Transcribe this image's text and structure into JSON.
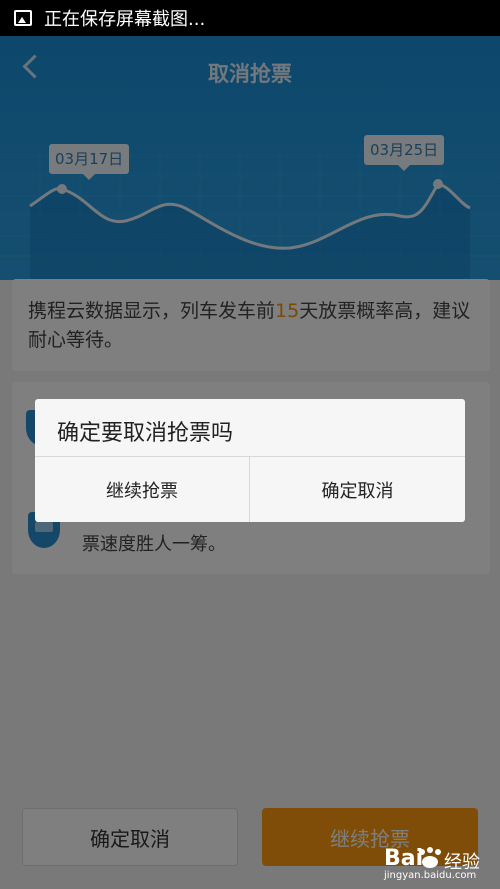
{
  "status_bar": {
    "text": "正在保存屏幕截图..."
  },
  "header": {
    "title": "取消抢票",
    "chart_tags": [
      "03月17日",
      "03月25日"
    ]
  },
  "info": {
    "text_before": "携程云数据显示，列车发车前",
    "highlight": "15",
    "text_after": "天放票概率高，建议耐心等待。"
  },
  "list": {
    "item2_text": "票速度胜人一筹。"
  },
  "bottom": {
    "cancel_label": "确定取消",
    "continue_label": "继续抢票"
  },
  "dialog": {
    "title": "确定要取消抢票吗",
    "continue_label": "继续抢票",
    "confirm_label": "确定取消"
  },
  "watermark": {
    "logo": "Bai",
    "logo2": "经验",
    "url": "jingyan.baidu.com"
  }
}
